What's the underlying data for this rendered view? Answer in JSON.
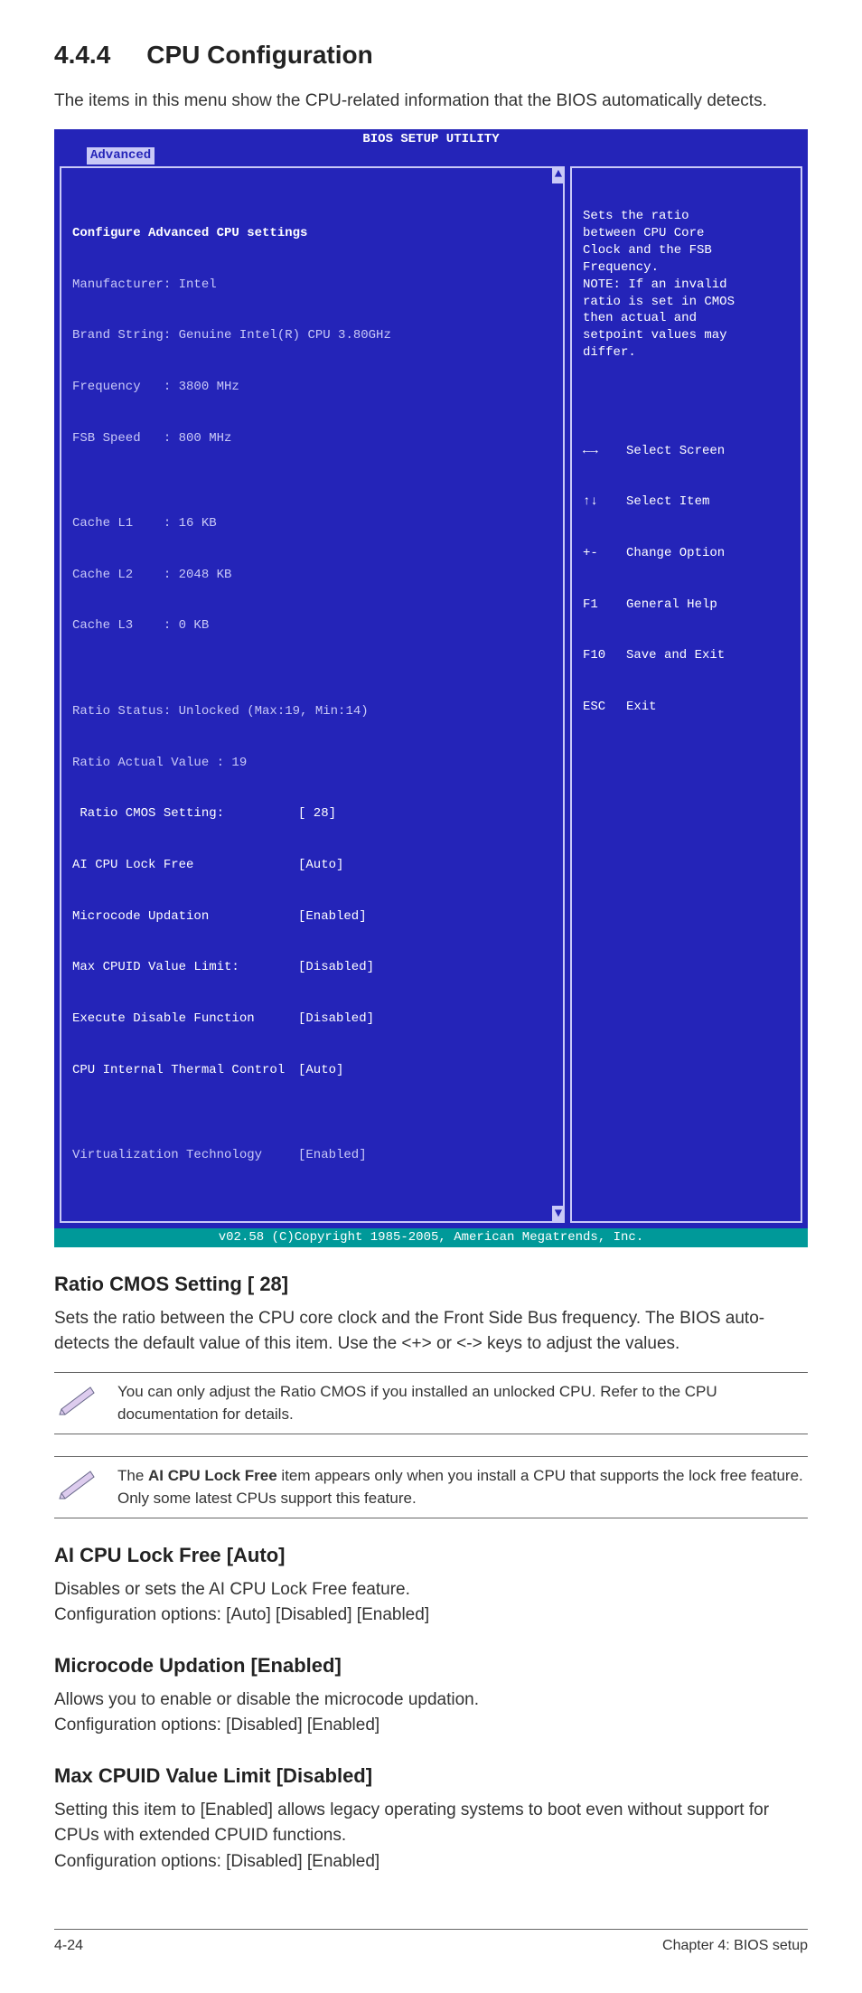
{
  "heading": {
    "number": "4.4.4",
    "title": "CPU Configuration"
  },
  "intro": "The items in this menu show the CPU-related information that the BIOS automatically detects.",
  "bios": {
    "title": "BIOS SETUP UTILITY",
    "active_tab": "Advanced",
    "left_heading": "Configure Advanced CPU settings",
    "info_lines": [
      "Manufacturer: Intel",
      "Brand String: Genuine Intel(R) CPU 3.80GHz",
      "Frequency   : 3800 MHz",
      "FSB Speed   : 800 MHz",
      "",
      "Cache L1    : 16 KB",
      "Cache L2    : 2048 KB",
      "Cache L3    : 0 KB",
      "",
      "Ratio Status: Unlocked (Max:19, Min:14)",
      "Ratio Actual Value : 19"
    ],
    "fields": [
      {
        "label": " Ratio CMOS Setting:",
        "value": "[ 28]",
        "highlight": true
      },
      {
        "label": "AI CPU Lock Free",
        "value": "[Auto]",
        "highlight": true
      },
      {
        "label": "Microcode Updation",
        "value": "[Enabled]",
        "highlight": true
      },
      {
        "label": "Max CPUID Value Limit:",
        "value": "[Disabled]",
        "highlight": true
      },
      {
        "label": "Execute Disable Function",
        "value": "[Disabled]",
        "highlight": true
      },
      {
        "label": "CPU Internal Thermal Control",
        "value": "[Auto]",
        "highlight": true
      },
      {
        "label": "",
        "value": "",
        "highlight": false
      },
      {
        "label": "Virtualization Technology",
        "value": "[Enabled]",
        "highlight": false
      }
    ],
    "help_text": "Sets the ratio\nbetween CPU Core\nClock and the FSB\nFrequency.\nNOTE: If an invalid\nratio is set in CMOS\nthen actual and\nsetpoint values may\ndiffer.",
    "keys": [
      {
        "k": "←→",
        "d": "Select Screen"
      },
      {
        "k": "↑↓",
        "d": "Select Item"
      },
      {
        "k": "+-",
        "d": "Change Option"
      },
      {
        "k": "F1",
        "d": "General Help"
      },
      {
        "k": "F10",
        "d": "Save and Exit"
      },
      {
        "k": "ESC",
        "d": "Exit"
      }
    ],
    "footer": "v02.58 (C)Copyright 1985-2005, American Megatrends, Inc."
  },
  "sections": {
    "ratio": {
      "title": "Ratio CMOS Setting [ 28]",
      "body": "Sets the ratio between the CPU core clock and the Front Side Bus frequency. The BIOS auto-detects the default value of this item. Use the <+> or <-> keys to adjust the values."
    },
    "ai_lock": {
      "title": "AI CPU Lock Free [Auto]",
      "body1": "Disables or sets the AI CPU Lock Free feature.",
      "body2": "Configuration options: [Auto] [Disabled] [Enabled]"
    },
    "microcode": {
      "title": "Microcode Updation [Enabled]",
      "body1": "Allows you to enable or disable the microcode updation.",
      "body2": "Configuration options: [Disabled] [Enabled]"
    },
    "cpuid": {
      "title": "Max CPUID Value Limit [Disabled]",
      "body1": "Setting this item to [Enabled] allows legacy operating systems to boot even without support for CPUs with extended CPUID functions.",
      "body2": "Configuration options: [Disabled] [Enabled]"
    }
  },
  "notes": {
    "note1": "You can only adjust the Ratio CMOS if you installed an unlocked CPU. Refer to the CPU documentation for details.",
    "note2_prefix": "The ",
    "note2_bold": "AI CPU Lock Free",
    "note2_suffix": " item appears only when you install a CPU that supports the lock free feature. Only some latest CPUs support this feature."
  },
  "footer": {
    "left": "4-24",
    "right": "Chapter 4: BIOS setup"
  }
}
